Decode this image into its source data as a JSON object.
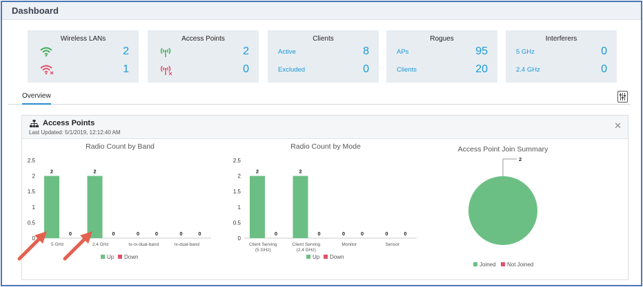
{
  "header": {
    "title": "Dashboard"
  },
  "cards": [
    {
      "title": "Wireless LANs",
      "rows": [
        {
          "icon": "wifi-up-icon",
          "value": "2"
        },
        {
          "icon": "wifi-down-icon",
          "value": "1"
        }
      ]
    },
    {
      "title": "Access Points",
      "rows": [
        {
          "icon": "ap-up-icon",
          "value": "2"
        },
        {
          "icon": "ap-down-icon",
          "value": "0"
        }
      ]
    },
    {
      "title": "Clients",
      "rows": [
        {
          "label": "Active",
          "value": "8"
        },
        {
          "label": "Excluded",
          "value": "0"
        }
      ]
    },
    {
      "title": "Rogues",
      "rows": [
        {
          "label": "APs",
          "value": "95"
        },
        {
          "label": "Clients",
          "value": "20"
        }
      ]
    },
    {
      "title": "Interferers",
      "rows": [
        {
          "label": "5 GHz",
          "value": "0"
        },
        {
          "label": "2.4 GHz",
          "value": "0"
        }
      ]
    }
  ],
  "tabs": {
    "overview": "Overview"
  },
  "panel": {
    "title": "Access Points",
    "last_updated": "Last Updated: 5/1/2019, 12:12:40 AM"
  },
  "colors": {
    "up": "#6cbf84",
    "down": "#e0506a",
    "accent": "#1a9ad6",
    "arrow": "#e4604f"
  },
  "chart_data": [
    {
      "type": "bar",
      "title": "Radio Count by Band",
      "categories": [
        "5 GHz",
        "2.4 GHz",
        "tx-rx-dual-band",
        "rx-dual-band"
      ],
      "series": [
        {
          "name": "Up",
          "values": [
            2,
            2,
            0,
            0
          ]
        },
        {
          "name": "Down",
          "values": [
            0,
            0,
            0,
            0
          ]
        }
      ],
      "ylim": [
        0,
        2.5
      ],
      "yticks": [
        "0",
        "0.5",
        "1",
        "1.5",
        "2",
        "2.5"
      ],
      "legend": "bottom"
    },
    {
      "type": "bar",
      "title": "Radio Count by Mode",
      "categories": [
        "Client Serving (5 GHz)",
        "Client Serving (2.4 GHz)",
        "Monitor",
        "Sensor"
      ],
      "series": [
        {
          "name": "Up",
          "values": [
            2,
            2,
            0,
            0
          ]
        },
        {
          "name": "Down",
          "values": [
            0,
            0,
            0,
            0
          ]
        }
      ],
      "ylim": [
        0,
        2.5
      ],
      "yticks": [
        "0",
        "0.5",
        "1",
        "1.5",
        "2",
        "2.5"
      ],
      "legend": "bottom"
    },
    {
      "type": "pie",
      "title": "Access Point Join Summary",
      "categories": [
        "Joined",
        "Not Joined"
      ],
      "values": [
        2,
        0
      ],
      "label": "2",
      "legend": "bottom"
    }
  ]
}
